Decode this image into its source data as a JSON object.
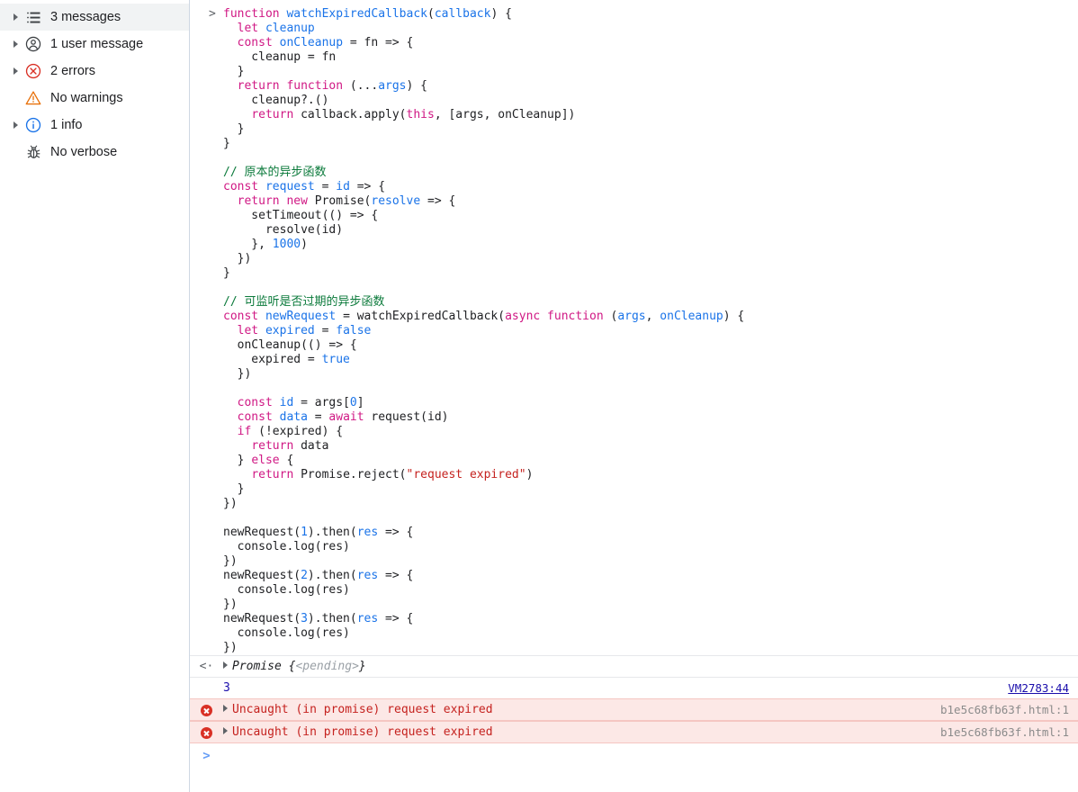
{
  "sidebar": {
    "items": [
      {
        "label": "3 messages",
        "icon": "list-icon",
        "expandable": true,
        "selected": true
      },
      {
        "label": "1 user message",
        "icon": "user-icon",
        "expandable": true,
        "selected": false
      },
      {
        "label": "2 errors",
        "icon": "error-icon",
        "expandable": true,
        "selected": false
      },
      {
        "label": "No warnings",
        "icon": "warning-icon",
        "expandable": false,
        "selected": false
      },
      {
        "label": "1 info",
        "icon": "info-icon",
        "expandable": true,
        "selected": false
      },
      {
        "label": "No verbose",
        "icon": "bug-icon",
        "expandable": false,
        "selected": false
      }
    ]
  },
  "console": {
    "input_marker": ">",
    "output_marker": "<·",
    "prompt_marker": ">",
    "code_lines": [
      [
        {
          "t": "function",
          "c": "kw2"
        },
        {
          "t": " ",
          "c": "plain"
        },
        {
          "t": "watchExpiredCallback",
          "c": "id"
        },
        {
          "t": "(",
          "c": "plain"
        },
        {
          "t": "callback",
          "c": "id"
        },
        {
          "t": ") {",
          "c": "plain"
        }
      ],
      [
        {
          "t": "  ",
          "c": "plain"
        },
        {
          "t": "let",
          "c": "kw2"
        },
        {
          "t": " ",
          "c": "plain"
        },
        {
          "t": "cleanup",
          "c": "id"
        }
      ],
      [
        {
          "t": "  ",
          "c": "plain"
        },
        {
          "t": "const",
          "c": "kw2"
        },
        {
          "t": " ",
          "c": "plain"
        },
        {
          "t": "onCleanup",
          "c": "id"
        },
        {
          "t": " = fn => {",
          "c": "plain"
        }
      ],
      [
        {
          "t": "    cleanup = fn",
          "c": "plain"
        }
      ],
      [
        {
          "t": "  }",
          "c": "plain"
        }
      ],
      [
        {
          "t": "  ",
          "c": "plain"
        },
        {
          "t": "return function",
          "c": "kw2"
        },
        {
          "t": " (...",
          "c": "plain"
        },
        {
          "t": "args",
          "c": "id"
        },
        {
          "t": ") {",
          "c": "plain"
        }
      ],
      [
        {
          "t": "    cleanup?.()",
          "c": "plain"
        }
      ],
      [
        {
          "t": "    ",
          "c": "plain"
        },
        {
          "t": "return",
          "c": "kw2"
        },
        {
          "t": " callback.apply(",
          "c": "plain"
        },
        {
          "t": "this",
          "c": "kw2"
        },
        {
          "t": ", [args, onCleanup])",
          "c": "plain"
        }
      ],
      [
        {
          "t": "  }",
          "c": "plain"
        }
      ],
      [
        {
          "t": "}",
          "c": "plain"
        }
      ],
      [
        {
          "t": "",
          "c": "plain"
        }
      ],
      [
        {
          "t": "// 原本的异步函数",
          "c": "com"
        }
      ],
      [
        {
          "t": "const",
          "c": "kw2"
        },
        {
          "t": " ",
          "c": "plain"
        },
        {
          "t": "request",
          "c": "id"
        },
        {
          "t": " = ",
          "c": "plain"
        },
        {
          "t": "id",
          "c": "id"
        },
        {
          "t": " => {",
          "c": "plain"
        }
      ],
      [
        {
          "t": "  ",
          "c": "plain"
        },
        {
          "t": "return new",
          "c": "kw2"
        },
        {
          "t": " Promise(",
          "c": "plain"
        },
        {
          "t": "resolve",
          "c": "id"
        },
        {
          "t": " => {",
          "c": "plain"
        }
      ],
      [
        {
          "t": "    setTimeout(() => {",
          "c": "plain"
        }
      ],
      [
        {
          "t": "      resolve(id)",
          "c": "plain"
        }
      ],
      [
        {
          "t": "    }, ",
          "c": "plain"
        },
        {
          "t": "1000",
          "c": "num"
        },
        {
          "t": ")",
          "c": "plain"
        }
      ],
      [
        {
          "t": "  })",
          "c": "plain"
        }
      ],
      [
        {
          "t": "}",
          "c": "plain"
        }
      ],
      [
        {
          "t": "",
          "c": "plain"
        }
      ],
      [
        {
          "t": "// 可监听是否过期的异步函数",
          "c": "com"
        }
      ],
      [
        {
          "t": "const",
          "c": "kw2"
        },
        {
          "t": " ",
          "c": "plain"
        },
        {
          "t": "newRequest",
          "c": "id"
        },
        {
          "t": " = watchExpiredCallback(",
          "c": "plain"
        },
        {
          "t": "async function",
          "c": "kw2"
        },
        {
          "t": " (",
          "c": "plain"
        },
        {
          "t": "args",
          "c": "id"
        },
        {
          "t": ", ",
          "c": "plain"
        },
        {
          "t": "onCleanup",
          "c": "id"
        },
        {
          "t": ") {",
          "c": "plain"
        }
      ],
      [
        {
          "t": "  ",
          "c": "plain"
        },
        {
          "t": "let",
          "c": "kw2"
        },
        {
          "t": " ",
          "c": "plain"
        },
        {
          "t": "expired",
          "c": "id"
        },
        {
          "t": " = ",
          "c": "plain"
        },
        {
          "t": "false",
          "c": "num"
        }
      ],
      [
        {
          "t": "  onCleanup(() => {",
          "c": "plain"
        }
      ],
      [
        {
          "t": "    expired = ",
          "c": "plain"
        },
        {
          "t": "true",
          "c": "num"
        }
      ],
      [
        {
          "t": "  })",
          "c": "plain"
        }
      ],
      [
        {
          "t": "",
          "c": "plain"
        }
      ],
      [
        {
          "t": "  ",
          "c": "plain"
        },
        {
          "t": "const",
          "c": "kw2"
        },
        {
          "t": " ",
          "c": "plain"
        },
        {
          "t": "id",
          "c": "id"
        },
        {
          "t": " = args[",
          "c": "plain"
        },
        {
          "t": "0",
          "c": "num"
        },
        {
          "t": "]",
          "c": "plain"
        }
      ],
      [
        {
          "t": "  ",
          "c": "plain"
        },
        {
          "t": "const",
          "c": "kw2"
        },
        {
          "t": " ",
          "c": "plain"
        },
        {
          "t": "data",
          "c": "id"
        },
        {
          "t": " = ",
          "c": "plain"
        },
        {
          "t": "await",
          "c": "kw2"
        },
        {
          "t": " request(id)",
          "c": "plain"
        }
      ],
      [
        {
          "t": "  ",
          "c": "plain"
        },
        {
          "t": "if",
          "c": "kw2"
        },
        {
          "t": " (!expired) {",
          "c": "plain"
        }
      ],
      [
        {
          "t": "    ",
          "c": "plain"
        },
        {
          "t": "return",
          "c": "kw2"
        },
        {
          "t": " data",
          "c": "plain"
        }
      ],
      [
        {
          "t": "  } ",
          "c": "plain"
        },
        {
          "t": "else",
          "c": "kw2"
        },
        {
          "t": " {",
          "c": "plain"
        }
      ],
      [
        {
          "t": "    ",
          "c": "plain"
        },
        {
          "t": "return",
          "c": "kw2"
        },
        {
          "t": " Promise.reject(",
          "c": "plain"
        },
        {
          "t": "\"request expired\"",
          "c": "str"
        },
        {
          "t": ")",
          "c": "plain"
        }
      ],
      [
        {
          "t": "  }",
          "c": "plain"
        }
      ],
      [
        {
          "t": "})",
          "c": "plain"
        }
      ],
      [
        {
          "t": "",
          "c": "plain"
        }
      ],
      [
        {
          "t": "newRequest(",
          "c": "plain"
        },
        {
          "t": "1",
          "c": "num"
        },
        {
          "t": ").then(",
          "c": "plain"
        },
        {
          "t": "res",
          "c": "id"
        },
        {
          "t": " => {",
          "c": "plain"
        }
      ],
      [
        {
          "t": "  console.log(res)",
          "c": "plain"
        }
      ],
      [
        {
          "t": "})",
          "c": "plain"
        }
      ],
      [
        {
          "t": "newRequest(",
          "c": "plain"
        },
        {
          "t": "2",
          "c": "num"
        },
        {
          "t": ").then(",
          "c": "plain"
        },
        {
          "t": "res",
          "c": "id"
        },
        {
          "t": " => {",
          "c": "plain"
        }
      ],
      [
        {
          "t": "  console.log(res)",
          "c": "plain"
        }
      ],
      [
        {
          "t": "})",
          "c": "plain"
        }
      ],
      [
        {
          "t": "newRequest(",
          "c": "plain"
        },
        {
          "t": "3",
          "c": "num"
        },
        {
          "t": ").then(",
          "c": "plain"
        },
        {
          "t": "res",
          "c": "id"
        },
        {
          "t": " => {",
          "c": "plain"
        }
      ],
      [
        {
          "t": "  console.log(res)",
          "c": "plain"
        }
      ],
      [
        {
          "t": "})",
          "c": "plain"
        }
      ]
    ],
    "results": [
      {
        "kind": "return",
        "marker": "<·",
        "expandable": true,
        "text": "Promise ",
        "suffix_brace_open": "{",
        "suffix_pending": "<pending>",
        "suffix_brace_close": "}",
        "source": ""
      },
      {
        "kind": "log",
        "marker": "",
        "expandable": false,
        "text": "3",
        "source": "VM2783:44"
      },
      {
        "kind": "error",
        "marker": "",
        "expandable": true,
        "text": "Uncaught (in promise) request expired",
        "source": "b1e5c68fb63f.html:1"
      },
      {
        "kind": "error",
        "marker": "",
        "expandable": true,
        "text": "Uncaught (in promise) request expired",
        "source": "b1e5c68fb63f.html:1"
      }
    ]
  },
  "colors": {
    "keyword": "#d01884",
    "identifier": "#1a73e8",
    "string": "#c5221f",
    "comment": "#0b7a3b",
    "number": "#1a73e8",
    "error_text": "#c5221f",
    "error_bg": "#fce8e6",
    "link": "#1a0dab",
    "selected_row": "#f1f3f4"
  }
}
